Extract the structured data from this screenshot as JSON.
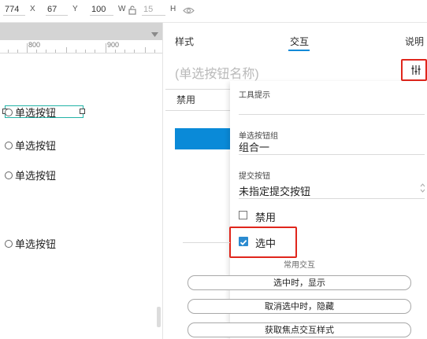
{
  "toolbar": {
    "x_value": "774",
    "x_label": "X",
    "y_value": "67",
    "y_label": "Y",
    "w_value": "100",
    "w_label": "W",
    "h_value": "15",
    "h_label": "H"
  },
  "ruler": {
    "ticks": [
      "800",
      "900"
    ]
  },
  "canvas": {
    "radio_label": "单选按钮"
  },
  "panel": {
    "tabs": [
      "样式",
      "交互",
      "说明"
    ],
    "active_tab": "交互",
    "name_placeholder": "(单选按钮名称)",
    "disabled_tab": "禁用"
  },
  "menu": {
    "tooltip_label": "工具提示",
    "group_label": "单选按钮组",
    "group_value": "组合一",
    "submit_label": "提交按钮",
    "submit_value": "未指定提交按钮",
    "disabled_label": "禁用",
    "checked_label": "选中"
  },
  "interactions": {
    "title": "常用交互",
    "buttons": [
      "选中时，显示",
      "取消选中时，隐藏",
      "获取焦点交互样式"
    ]
  },
  "colors": {
    "accent": "#0a8ad8",
    "highlight": "#e0261c",
    "checkbox": "#2b8bd0"
  }
}
